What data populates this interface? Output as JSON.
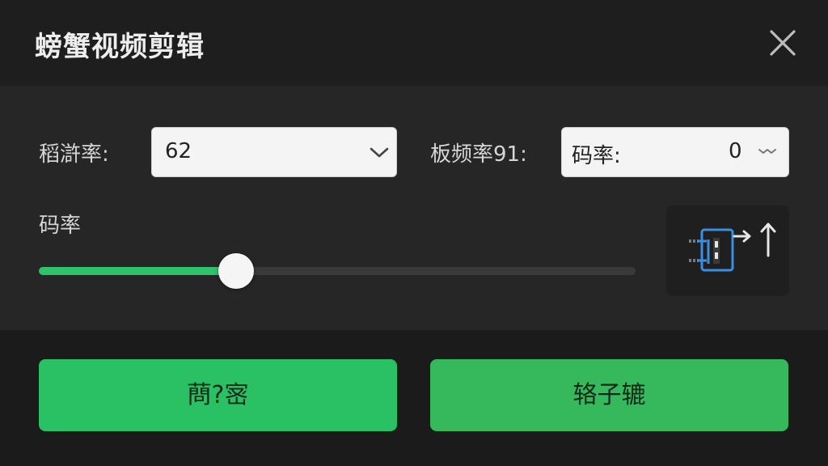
{
  "window": {
    "title": "螃蟹视频剪辑"
  },
  "settings": {
    "field1_label": "稻滸率:",
    "field1_value": "62",
    "field2_label": "板频率91:",
    "field2_value_label": "码率:",
    "field2_value": "0",
    "slider_label": "码率",
    "slider_fraction": 0.33
  },
  "buttons": {
    "left_label": "蔄?宻",
    "right_label": "辂子辘"
  },
  "icons": {
    "close": "close-icon",
    "export": "export-arrow-icon",
    "chevron": "chevron-down-icon"
  },
  "colors": {
    "accent": "#2ec26a",
    "button_left": "#29c163",
    "button_right": "#36b95c",
    "icon_blue": "#3b8fe0"
  }
}
